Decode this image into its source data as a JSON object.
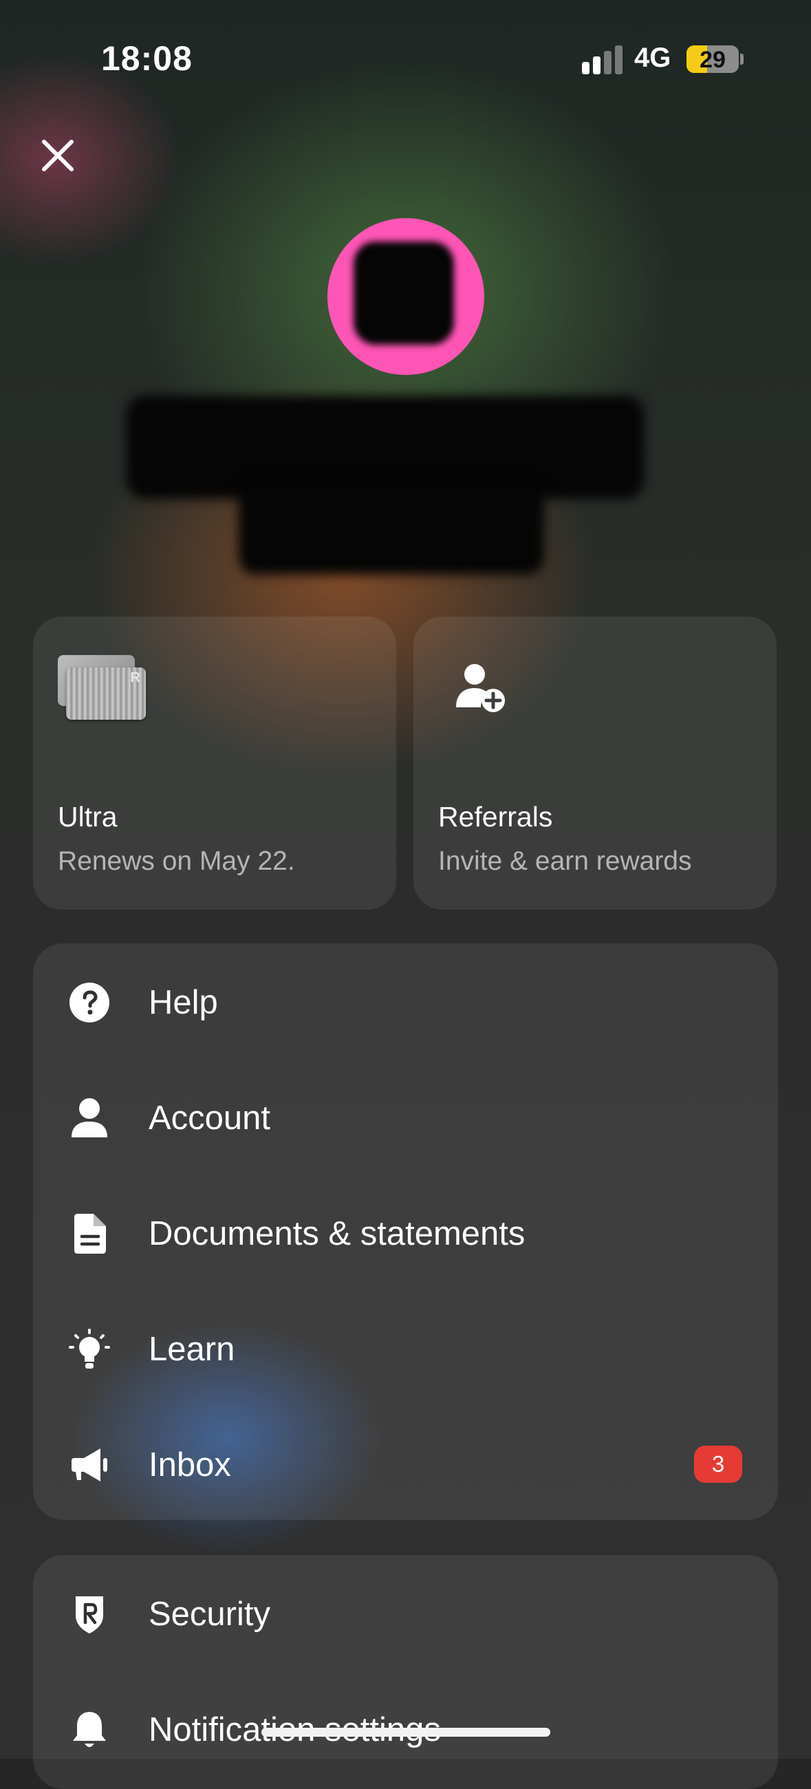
{
  "status_bar": {
    "time": "18:08",
    "network": "4G",
    "battery": "29"
  },
  "profile": {
    "close_icon": "close-icon",
    "avatar_color": "#ff55b6"
  },
  "cards": [
    {
      "icon": "plan-card-icon",
      "title": "Ultra",
      "subtitle": "Renews on May 22."
    },
    {
      "icon": "add-person-icon",
      "title": "Referrals",
      "subtitle": "Invite & earn rewards"
    }
  ],
  "menu_primary": [
    {
      "icon": "help-icon",
      "label": "Help"
    },
    {
      "icon": "person-icon",
      "label": "Account"
    },
    {
      "icon": "document-icon",
      "label": "Documents & statements"
    },
    {
      "icon": "lightbulb-icon",
      "label": "Learn"
    },
    {
      "icon": "megaphone-icon",
      "label": "Inbox",
      "badge": "3"
    }
  ],
  "menu_secondary": [
    {
      "icon": "shield-icon",
      "label": "Security"
    },
    {
      "icon": "bell-icon",
      "label": "Notification settings"
    }
  ],
  "colors": {
    "badge": "#e63b35",
    "battery": "#f5cc15"
  }
}
